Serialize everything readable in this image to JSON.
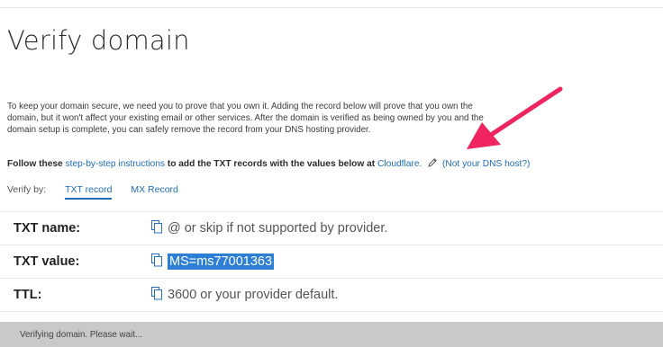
{
  "page": {
    "title": "Verify domain"
  },
  "intro": {
    "text": "To keep your domain secure, we need you to prove that you own it. Adding the record below will prove that you own the domain, but it won't affect your existing email or other services. After the domain is verified as being owned by you and the domain setup is complete, you can safely remove the record from your DNS hosting provider."
  },
  "follow": {
    "prefix": "Follow these",
    "link_instructions": "step-by-step instructions",
    "middle": "to add the TXT records with the values below at",
    "link_host": "Cloudflare.",
    "link_not_host": "(Not your DNS host?)"
  },
  "verify": {
    "label": "Verify by:",
    "tabs": [
      {
        "label": "TXT record",
        "active": true
      },
      {
        "label": "MX Record",
        "active": false
      }
    ]
  },
  "records": [
    {
      "label": "TXT name:",
      "value": "@ or skip if not supported by provider."
    },
    {
      "label": "TXT value:",
      "value": "MS=ms77001363"
    },
    {
      "label": "TTL:",
      "value": "3600 or your provider default."
    }
  ],
  "status": {
    "text": "Verifying domain. Please wait..."
  },
  "colors": {
    "link": "#1f6db8",
    "selection": "#2d7fd6",
    "annotation_arrow": "#f0245e",
    "status_bar": "#c9c9c9"
  },
  "icons": [
    "copy-icon",
    "pencil-icon",
    "arrow-annotation"
  ]
}
